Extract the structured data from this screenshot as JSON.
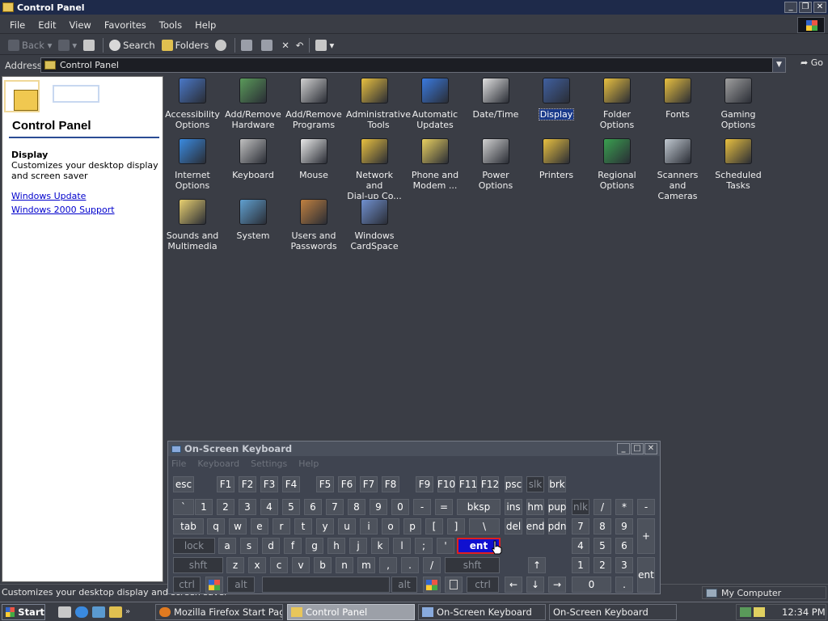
{
  "window": {
    "title": "Control Panel"
  },
  "menu": [
    "File",
    "Edit",
    "View",
    "Favorites",
    "Tools",
    "Help"
  ],
  "toolbar": {
    "back": "Back",
    "search": "Search",
    "folders": "Folders"
  },
  "address": {
    "label": "Address",
    "value": "Control Panel",
    "go": "Go"
  },
  "left": {
    "title": "Control Panel",
    "heading": "Display",
    "description": "Customizes your desktop display and screen saver",
    "links": [
      "Windows Update",
      "Windows 2000 Support"
    ]
  },
  "items": [
    {
      "l1": "Accessibility",
      "l2": "Options",
      "icon": "accessibility-icon",
      "color": "#4a78c8"
    },
    {
      "l1": "Add/Remove",
      "l2": "Hardware",
      "icon": "hardware-icon",
      "color": "#5a9a5a"
    },
    {
      "l1": "Add/Remove",
      "l2": "Programs",
      "icon": "programs-icon",
      "color": "#d0d0d0"
    },
    {
      "l1": "Administrative",
      "l2": "Tools",
      "icon": "admin-tools-icon",
      "color": "#e8c040"
    },
    {
      "l1": "Automatic",
      "l2": "Updates",
      "icon": "updates-icon",
      "color": "#3a7ae0"
    },
    {
      "l1": "Date/Time",
      "l2": "",
      "icon": "calendar-icon",
      "color": "#e0e0e0"
    },
    {
      "l1": "Display",
      "l2": "",
      "icon": "display-icon",
      "color": "#4060a0",
      "selected": true
    },
    {
      "l1": "Folder Options",
      "l2": "",
      "icon": "folder-options-icon",
      "color": "#e8c040"
    },
    {
      "l1": "Fonts",
      "l2": "",
      "icon": "fonts-icon",
      "color": "#e8c040"
    },
    {
      "l1": "Gaming",
      "l2": "Options",
      "icon": "joystick-icon",
      "color": "#a0a0a0"
    },
    {
      "l1": "Internet",
      "l2": "Options",
      "icon": "internet-icon",
      "color": "#3a8ae0"
    },
    {
      "l1": "Keyboard",
      "l2": "",
      "icon": "keyboard-icon",
      "color": "#c0c0c0"
    },
    {
      "l1": "Mouse",
      "l2": "",
      "icon": "mouse-icon",
      "color": "#e8e8e8"
    },
    {
      "l1": "Network and",
      "l2": "Dial-up Co...",
      "icon": "network-icon",
      "color": "#e8c040"
    },
    {
      "l1": "Phone and",
      "l2": "Modem ...",
      "icon": "phone-icon",
      "color": "#e8d060"
    },
    {
      "l1": "Power Options",
      "l2": "",
      "icon": "power-icon",
      "color": "#d0d0d0"
    },
    {
      "l1": "Printers",
      "l2": "",
      "icon": "printer-icon",
      "color": "#e8c040"
    },
    {
      "l1": "Regional",
      "l2": "Options",
      "icon": "globe-icon",
      "color": "#3aa050"
    },
    {
      "l1": "Scanners and",
      "l2": "Cameras",
      "icon": "scanner-icon",
      "color": "#c0c8d0"
    },
    {
      "l1": "Scheduled",
      "l2": "Tasks",
      "icon": "scheduled-tasks-icon",
      "color": "#e8c040"
    },
    {
      "l1": "Sounds and",
      "l2": "Multimedia",
      "icon": "speaker-icon",
      "color": "#e8d070"
    },
    {
      "l1": "System",
      "l2": "",
      "icon": "computer-icon",
      "color": "#60a0d0"
    },
    {
      "l1": "Users and",
      "l2": "Passwords",
      "icon": "users-icon",
      "color": "#c08040"
    },
    {
      "l1": "Windows",
      "l2": "CardSpace",
      "icon": "cardspace-icon",
      "color": "#7090d0"
    }
  ],
  "status": {
    "left": "Customizes your desktop display and screen saver",
    "right": "My Computer"
  },
  "taskbar": {
    "start": "Start",
    "tasks": [
      "Mozilla Firefox Start Page...",
      "Control Panel",
      "On-Screen Keyboard",
      "On-Screen Keyboard"
    ],
    "clock": "12:34 PM"
  },
  "osk": {
    "title": "On-Screen Keyboard",
    "menu": [
      "File",
      "Keyboard",
      "Settings",
      "Help"
    ],
    "rows": [
      [
        "esc",
        "F1",
        "F2",
        "F3",
        "F4",
        "F5",
        "F6",
        "F7",
        "F8",
        "F9",
        "F10",
        "F11",
        "F12",
        "psc",
        "slk",
        "brk"
      ],
      [
        "`",
        "1",
        "2",
        "3",
        "4",
        "5",
        "6",
        "7",
        "8",
        "9",
        "0",
        "-",
        "=",
        "bksp",
        "ins",
        "hm",
        "pup",
        "nlk",
        "/",
        "*",
        "-"
      ],
      [
        "tab",
        "q",
        "w",
        "e",
        "r",
        "t",
        "y",
        "u",
        "i",
        "o",
        "p",
        "[",
        "]",
        "\\",
        "del",
        "end",
        "pdn",
        "7",
        "8",
        "9",
        "+"
      ],
      [
        "lock",
        "a",
        "s",
        "d",
        "f",
        "g",
        "h",
        "j",
        "k",
        "l",
        ";",
        "'",
        "ent",
        "4",
        "5",
        "6"
      ],
      [
        "shft",
        "z",
        "x",
        "c",
        "v",
        "b",
        "n",
        "m",
        ",",
        ".",
        "/",
        "shft",
        "↑",
        "1",
        "2",
        "3",
        "ent"
      ],
      [
        "ctrl",
        "",
        "alt",
        "",
        "alt",
        "",
        "",
        "ctrl",
        "←",
        "↓",
        "→",
        "0",
        "."
      ]
    ]
  }
}
